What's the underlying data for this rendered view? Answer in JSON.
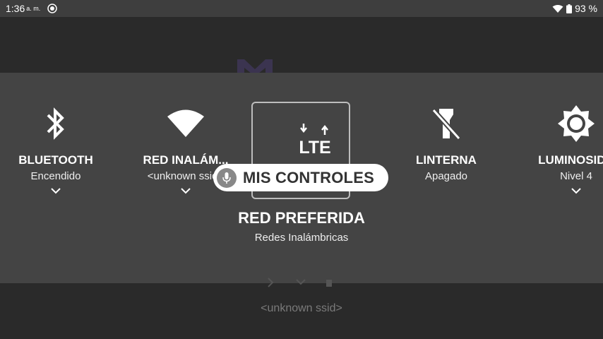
{
  "statusbar": {
    "time": "1:36",
    "ampm": "a. m.",
    "battery": "93 %",
    "icons": [
      "radio-icon",
      "wifi-icon",
      "battery-icon"
    ]
  },
  "background": {
    "ssid": "<unknown ssid>"
  },
  "tiles": [
    {
      "name": "bluetooth",
      "icon": "bluetooth-icon",
      "title": "BLUETOOTH",
      "status": "Encendido"
    },
    {
      "name": "wifi",
      "icon": "wifi-icon",
      "title": "RED INALÁM...",
      "status": "<unknown ssid>"
    },
    {
      "name": "flashlight",
      "icon": "flashlight-off-icon",
      "title": "LINTERNA",
      "status": "Apagado"
    },
    {
      "name": "brightness",
      "icon": "brightness-icon",
      "title": "LUMINOSIDA",
      "status": "Nivel 4"
    }
  ],
  "focused_tile": {
    "icon": "lte-data-icon",
    "icon_text": "LTE",
    "title": "RED PREFERIDA",
    "status": "Redes Inalámbricas"
  },
  "voice_pill": {
    "label": "MIS CONTROLES",
    "icon": "mic-icon"
  },
  "colors": {
    "panel": "#444444",
    "statusbar": "#3e3e3e",
    "background": "#2a2a2a",
    "pill": "#ffffff"
  }
}
